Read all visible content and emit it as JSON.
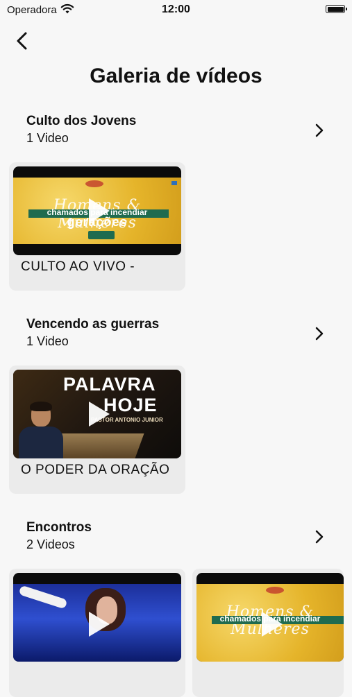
{
  "status": {
    "carrier": "Operadora",
    "time": "12:00"
  },
  "header": {
    "title": "Galeria de vídeos"
  },
  "sections": [
    {
      "name": "Culto dos Jovens",
      "count": "1 Video",
      "videos": [
        {
          "title": "CULTO AO VIVO -",
          "thumb": "homens-mulheres-banner"
        }
      ]
    },
    {
      "name": "Vencendo as guerras",
      "count": "1 Video",
      "videos": [
        {
          "title": "O PODER DA ORAÇÃO",
          "thumb": "palavra-de-hoje-banner"
        }
      ]
    },
    {
      "name": "Encontros",
      "count": "2 Videos",
      "videos": [
        {
          "title": "",
          "thumb": "worship-stage"
        },
        {
          "title": "",
          "thumb": "homens-mulheres-banner"
        }
      ]
    }
  ],
  "thumbnails": {
    "homens": {
      "line1": "Homens & Mulheres",
      "line2": "chamados para incendiar",
      "line3": "gerações"
    },
    "palavra": {
      "line1": "PALAVRA",
      "line2": "HOJE",
      "line3": "PASTOR ANTONIO JUNIOR"
    }
  },
  "icons": {
    "back": "chevron-left-icon",
    "section_arrow": "chevron-right-icon",
    "play": "play-icon",
    "wifi": "wifi-icon",
    "battery": "battery-icon"
  }
}
